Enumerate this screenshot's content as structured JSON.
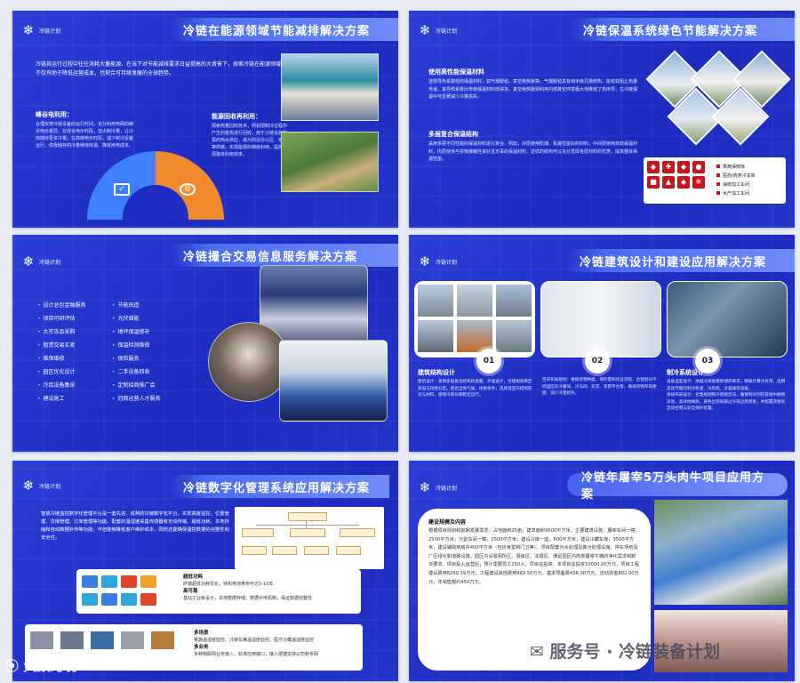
{
  "logo_text": "冷链计划",
  "slides": {
    "s1": {
      "title": "冷链在能源领域节能减排解决方案",
      "intro": "冷链其运行过程中往往消耗大量能源，在当下对节能减排要求日益提高的大背景下，探索冷链在能源领域的节能减排解决方案显得尤为迫切，这不仅有助于降低运营成本，也契合可持续发展的全球趋势。",
      "left_heading": "峰谷电利用：",
      "left_body": "合理安排冷链设备的运行时间，充分利用电网的峰谷电价差异。在低谷电价时段，加大制冷量，让冷库储存更多冷量；在高峰电价时段，减少制冷设备运行，依靠储存的冷量维持库温，降低用电成本。",
      "right_heading": "能源回收再利用：",
      "right_body": "探索热量回收技术，例如把制冷过程中产生的废热进行回收，用于冷链设施所需的热水供应，或为附近办公区、宿舍等供暖，实现能源的梯级利用，提高能源整体利用效率。"
    },
    "s2": {
      "title": "冷链保温系统绿色节能解决方案",
      "h1": "使用高性能保温材料",
      "p1": "选择导热系数低的保温材料，如气凝胶毡、真空绝热板等。气凝胶毡具有纳米级孔隙结构，能有效阻止热量传递，其导热系数比传统保温材料低得多。真空绝热板则利用内部真空环境极大地降低了热传导，在冷链保温中可显著减少冷量损失。",
      "h2": "多层复合保温结构",
      "p2": "采用多层不同性能的保温材料进行复合，例如，外层使用防潮、机械性能好的材料，中间层使用高效保温材料，内层使用与货物接触性良好且无毒的保温材料，这样的结构可以充分发挥各层材料的优势，提高整体保温性能。",
      "legend": [
        "果蔬保鲜库",
        "医药/肉类冷冻库",
        "海鲜加工车间",
        "水产加工车间"
      ]
    },
    "s3": {
      "title": "冷链撮合交易信息服务解决方案",
      "col1": [
        "设计总包金融服务",
        "项目可研评估",
        "大宗冻品采购",
        "租赁交易买卖",
        "维保维修",
        "园区优化设计",
        "冷库设备集采",
        "建设施工"
      ],
      "col2": [
        "节能改造",
        "光伏储能",
        "地坪保温修补",
        "保温检测维修",
        "保险服务",
        "二手设备回收",
        "定制招商推广会",
        "冠商运营人才服务"
      ]
    },
    "s4": {
      "title": "冷链建筑设计和建设应用解决方案",
      "nums": [
        "01",
        "02",
        "03"
      ],
      "c1_title": "建筑结构设计",
      "c1_body": "建筑设计：采用多层复合结构的屋面、外墙设计，合理规划库区布局与功能分区，结合当地气候、地质条件，选择适宜的结构形式与材料，保障冷库长期稳定运行。",
      "c2_title": "空间布局规划",
      "c2_body": "空间布局规划：根据货物种类、储存量和作业流程，合理划分不同温区的冷藏间、冷冻间、穿堂、装卸平台等，确保货物存取便捷、减少冷量损失。",
      "c3_title": "制冷系统设计",
      "c3_body": "设备选型设计：依据冷库规模和储存要求，精确计算冷负荷，选用高效节能的制冷机组、冷风机、冷凝器等设备。\n系统布局设计：合理规划制冷管路走向，确保制冷剂在管道中顺畅流动，高效地换热，避免出现局部过冷或过热现象，并配置完善的自动控制与安全保护装置。"
    },
    "s5": {
      "title": "冷链数字化管理系统应用解决方案",
      "intro": "智慧冷链监控数字化管理平台是一套先进、成熟的冷链数字化平台，实现高度监控、位置管理、交接管理、订单管理等功能。配套的温湿度采集传感器有无线传输、超低功耗、本地存储和自动数据补传等功能，不但能够降低客户维护成本，同时还能确保温控数据的完整性和安全性。",
      "p1_title": "超低功耗",
      "p1_body": "终端超低功耗优化，待机电池寿命可达5-10年",
      "p1_title2": "高可靠",
      "p1_body2": "基站工业级设计，本地数据存储，数据补传机制，保证数据完整性",
      "p2_title": "多场景",
      "p2_body": "果蔬温湿度监控、冷链车辆温湿度监控、医疗冷藏温湿度监控",
      "p2_title2": "多业务",
      "p2_body2": "多种物联网业务接入，标准应用接口，接入便捷支持公司和专网"
    },
    "s6": {
      "title": "冷链年屠宰5万头肉牛项目应用方案",
      "heading": "建设规模及内容",
      "body": "根据项目规划和前期发展需求，占地面积25亩，建筑面积9500平方米。主要建筑设施：屠宰车间一幢，2500平方米；分割车间一幢，2500平方米；建设冷库一座，600平方米；建设冷藏车库，3500平方米，建设辅助用房共400平方米（包括食堂和门卫等）。项目配套污水处理及粪污处理设施、停车场地及厂区绿化和道路设施。园区内设置厕所区、厨房区、冻银区，满足园区内肉类屠宰牛棚的净化需求和卸货要求。项目投入运营后，预计需要员工150人。项目总投资：本项目总投资10000.00万元，项目工程建设费用8290.59万元；工程建设其他费用469.50万元，基本预备费438.00万元，流动资金802.00万元，年销售额约450万元。"
    }
  },
  "watermarks": {
    "left": "大数跨境",
    "right_a": "服务号",
    "right_b": "冷链装备计划"
  }
}
